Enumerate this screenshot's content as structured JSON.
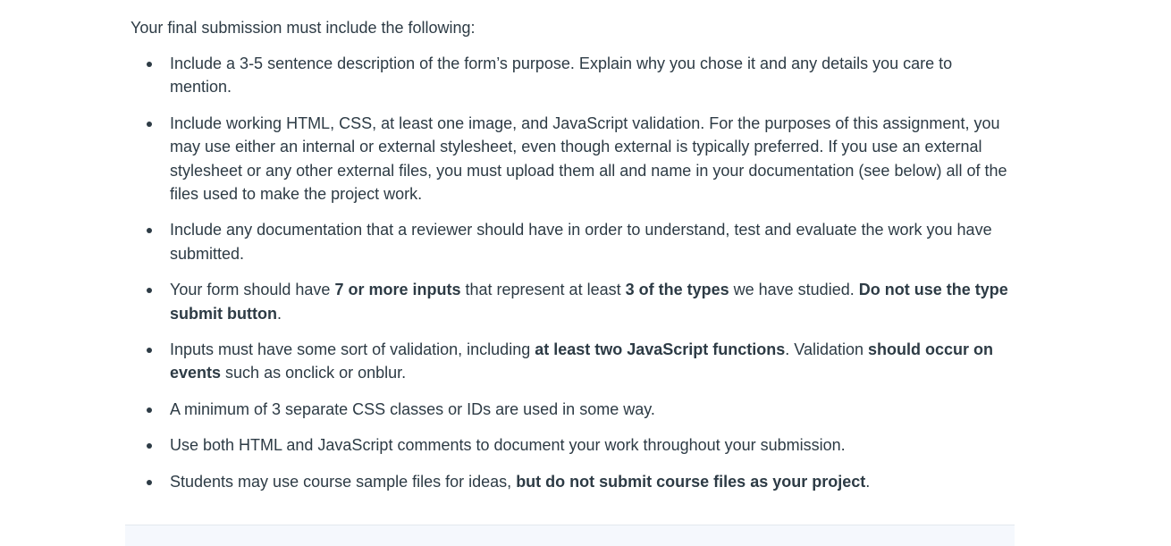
{
  "intro": "Your final submission must include the following:",
  "items": [
    {
      "segments": [
        {
          "text": "Include a 3-5 sentence description of the form’s purpose.  Explain why you chose it and any details you care to mention.",
          "bold": false
        }
      ]
    },
    {
      "segments": [
        {
          "text": "Include working HTML, CSS, at least one image, and JavaScript validation. For the purposes of this assignment, you may use either an internal or external stylesheet, even though external is typically preferred. If you use an external stylesheet or any other external files, you must upload them all and name in your documentation (see below) all of the files used to make the project work.",
          "bold": false
        }
      ]
    },
    {
      "segments": [
        {
          "text": "Include any documentation that a reviewer should have in order to understand, test and evaluate the work you have submitted.",
          "bold": false
        }
      ]
    },
    {
      "segments": [
        {
          "text": "Your form should have ",
          "bold": false
        },
        {
          "text": "7 or more inputs",
          "bold": true
        },
        {
          "text": " that represent at least ",
          "bold": false
        },
        {
          "text": "3 of the types",
          "bold": true
        },
        {
          "text": " we have studied.  ",
          "bold": false
        },
        {
          "text": "Do not use the type submit button",
          "bold": true
        },
        {
          "text": ".",
          "bold": false
        }
      ]
    },
    {
      "segments": [
        {
          "text": "Inputs must have some sort of validation, including ",
          "bold": false
        },
        {
          "text": "at least two JavaScript functions",
          "bold": true
        },
        {
          "text": ". Validation ",
          "bold": false
        },
        {
          "text": "should occur on events",
          "bold": true
        },
        {
          "text": " such as onclick or onblur.",
          "bold": false
        }
      ]
    },
    {
      "segments": [
        {
          "text": "A minimum of 3 separate CSS classes or IDs are used in some way.",
          "bold": false
        }
      ]
    },
    {
      "segments": [
        {
          "text": "Use both HTML and JavaScript comments to document your work throughout your submission.",
          "bold": false
        }
      ]
    },
    {
      "segments": [
        {
          "text": "Students may use course sample files for ideas, ",
          "bold": false
        },
        {
          "text": "but do not submit course files as your project",
          "bold": true
        },
        {
          "text": ".",
          "bold": false
        }
      ]
    }
  ]
}
